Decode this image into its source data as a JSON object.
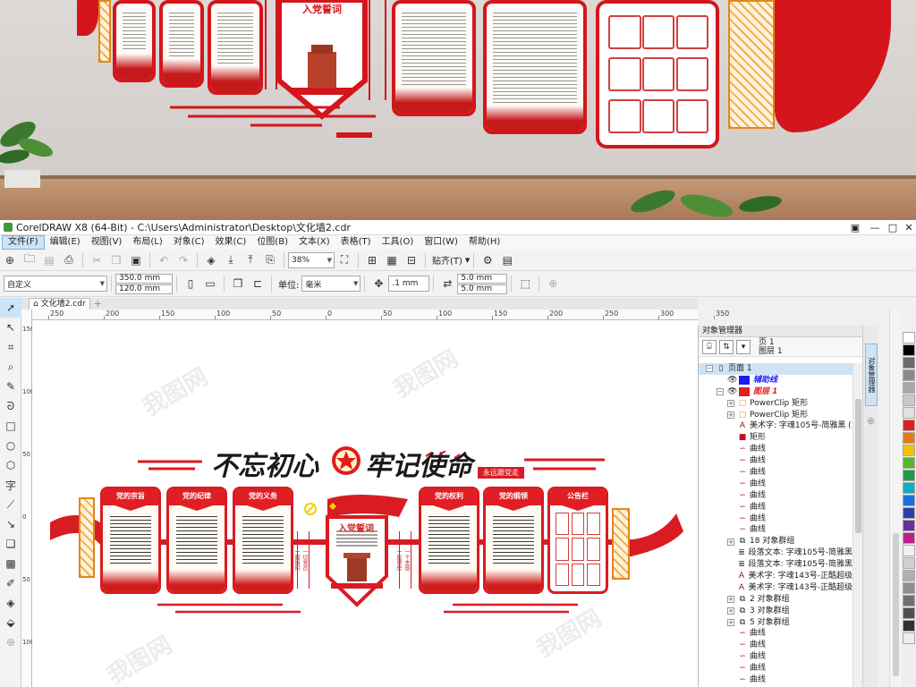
{
  "window": {
    "title": "CorelDRAW X8 (64-Bit) - C:\\Users\\Administrator\\Desktop\\文化墙2.cdr"
  },
  "menu": [
    "文件(F)",
    "编辑(E)",
    "视图(V)",
    "布局(L)",
    "对象(C)",
    "效果(C)",
    "位图(B)",
    "文本(X)",
    "表格(T)",
    "工具(O)",
    "窗口(W)",
    "帮助(H)"
  ],
  "toolbar1": {
    "zoom": "38%",
    "snap_label": "贴齐(T)"
  },
  "toolbar2": {
    "page_preset": "自定义",
    "width": "350.0 mm",
    "height": "120.0 mm",
    "units_label": "单位:",
    "units": "毫米",
    "nudge": ".1 mm",
    "dup_x": "5.0 mm",
    "dup_y": "5.0 mm"
  },
  "doc_tab": "文化墙2.cdr",
  "ruler_labels": [
    "250",
    "200",
    "150",
    "100",
    "50",
    "0",
    "50",
    "100",
    "150",
    "200",
    "250",
    "300",
    "350"
  ],
  "vruler_labels": [
    "150",
    "100",
    "50",
    "0",
    "50",
    "100"
  ],
  "design": {
    "headline_left": "不忘初心",
    "headline_right": "牢记使命",
    "tagline": "永远跟党走",
    "panels": [
      "党的宗旨",
      "党的纪律",
      "党的义务",
      "党的权利",
      "党的纲领",
      "公告栏"
    ],
    "oath_title": "入党誓词",
    "vert_left": [
      "一切党员",
      "一面旗帜"
    ],
    "vert_right": [
      "一个支部",
      "一座堡垒"
    ],
    "watermark": "我图网"
  },
  "photo": {
    "oath_title": "入党誓词"
  },
  "object_manager": {
    "title": "对象管理器",
    "page": "页 1",
    "layer": "图层 1",
    "tab_label": "对象管理器",
    "tree": [
      {
        "indent": 0,
        "expander": "⊟",
        "icon": "page",
        "label": "页面 1",
        "color": ""
      },
      {
        "indent": 1,
        "expander": "",
        "icon": "layer-guides",
        "label": "辅助线",
        "color": "#1a1aff"
      },
      {
        "indent": 1,
        "expander": "⊟",
        "icon": "layer",
        "label": "图层 1",
        "color": "#e81c1c"
      },
      {
        "indent": 2,
        "expander": "⊞",
        "icon": "powerclip",
        "label": "PowerClip 矩形",
        "color": ""
      },
      {
        "indent": 2,
        "expander": "⊞",
        "icon": "powerclip",
        "label": "PowerClip 矩形",
        "color": ""
      },
      {
        "indent": 2,
        "expander": "",
        "icon": "art-text",
        "label": "美术字: 字魂105号-简雅黑 (",
        "color": ""
      },
      {
        "indent": 2,
        "expander": "",
        "icon": "rect",
        "label": "矩形",
        "color": ""
      },
      {
        "indent": 2,
        "expander": "",
        "icon": "curve",
        "label": "曲线",
        "color": ""
      },
      {
        "indent": 2,
        "expander": "",
        "icon": "curve",
        "label": "曲线",
        "color": ""
      },
      {
        "indent": 2,
        "expander": "",
        "icon": "curve",
        "label": "曲线",
        "color": ""
      },
      {
        "indent": 2,
        "expander": "",
        "icon": "curve",
        "label": "曲线",
        "color": ""
      },
      {
        "indent": 2,
        "expander": "",
        "icon": "curve",
        "label": "曲线",
        "color": ""
      },
      {
        "indent": 2,
        "expander": "",
        "icon": "curve",
        "label": "曲线",
        "color": ""
      },
      {
        "indent": 2,
        "expander": "",
        "icon": "curve",
        "label": "曲线",
        "color": ""
      },
      {
        "indent": 2,
        "expander": "",
        "icon": "curve",
        "label": "曲线",
        "color": ""
      },
      {
        "indent": 2,
        "expander": "⊞",
        "icon": "group",
        "label": "18 对象群组",
        "color": ""
      },
      {
        "indent": 2,
        "expander": "",
        "icon": "para-text",
        "label": "段落文本: 字魂105号-简雅黑",
        "color": ""
      },
      {
        "indent": 2,
        "expander": "",
        "icon": "para-text",
        "label": "段落文本: 字魂105号-简雅黑",
        "color": ""
      },
      {
        "indent": 2,
        "expander": "",
        "icon": "art-text",
        "label": "美术字: 字魂143号-正酷超级",
        "color": ""
      },
      {
        "indent": 2,
        "expander": "",
        "icon": "art-text",
        "label": "美术字: 字魂143号-正酷超级",
        "color": ""
      },
      {
        "indent": 2,
        "expander": "⊞",
        "icon": "group",
        "label": "2 对象群组",
        "color": ""
      },
      {
        "indent": 2,
        "expander": "⊞",
        "icon": "group",
        "label": "3 对象群组",
        "color": ""
      },
      {
        "indent": 2,
        "expander": "⊞",
        "icon": "group",
        "label": "5 对象群组",
        "color": ""
      },
      {
        "indent": 2,
        "expander": "",
        "icon": "curve",
        "label": "曲线",
        "color": ""
      },
      {
        "indent": 2,
        "expander": "",
        "icon": "curve",
        "label": "曲线",
        "color": ""
      },
      {
        "indent": 2,
        "expander": "",
        "icon": "curve",
        "label": "曲线",
        "color": ""
      },
      {
        "indent": 2,
        "expander": "",
        "icon": "curve",
        "label": "曲线",
        "color": ""
      },
      {
        "indent": 2,
        "expander": "",
        "icon": "curve",
        "label": "曲线",
        "color": ""
      }
    ]
  },
  "palette": [
    "#ffffff",
    "#000000",
    "#6a6a6a",
    "#8a8a8a",
    "#a8a8a8",
    "#c8c8c8",
    "#e0e0e0",
    "#e01e1e",
    "#e87a12",
    "#f2c200",
    "#5ab52b",
    "#1c9c4a",
    "#0ab0c8",
    "#1a6fd8",
    "#2a3fa8",
    "#6b2fa0",
    "#c21e8a",
    "#f0f0f0",
    "#d0d0d0",
    "#b0b0b0",
    "#909090",
    "#707070",
    "#505050",
    "#303030",
    "#eeeeee"
  ]
}
